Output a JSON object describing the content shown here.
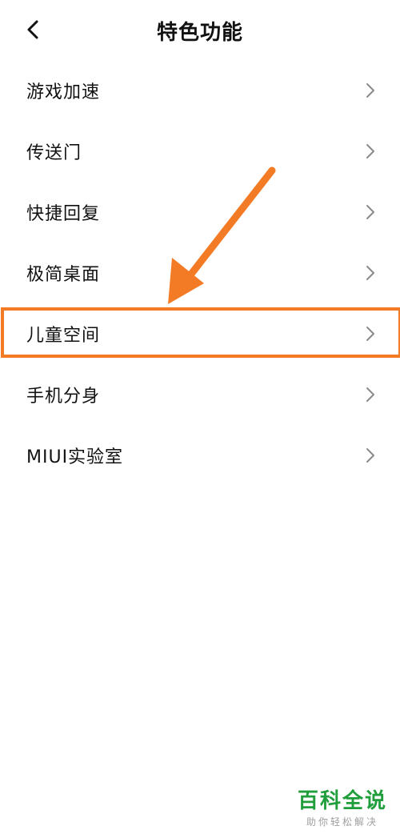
{
  "header": {
    "title": "特色功能",
    "back_icon": "chevron-left-icon"
  },
  "menu": {
    "items": [
      {
        "label": "游戏加速"
      },
      {
        "label": "传送门"
      },
      {
        "label": "快捷回复"
      },
      {
        "label": "极简桌面"
      },
      {
        "label": "儿童空间",
        "highlighted": true
      },
      {
        "label": "手机分身"
      },
      {
        "label": "MIUI实验室"
      }
    ],
    "chevron_icon": "chevron-right-icon"
  },
  "annotation": {
    "color": "#f47b25"
  },
  "watermark": {
    "title": "百科全说",
    "subtitle": "助你轻松解决",
    "color": "#1f9e3b"
  }
}
